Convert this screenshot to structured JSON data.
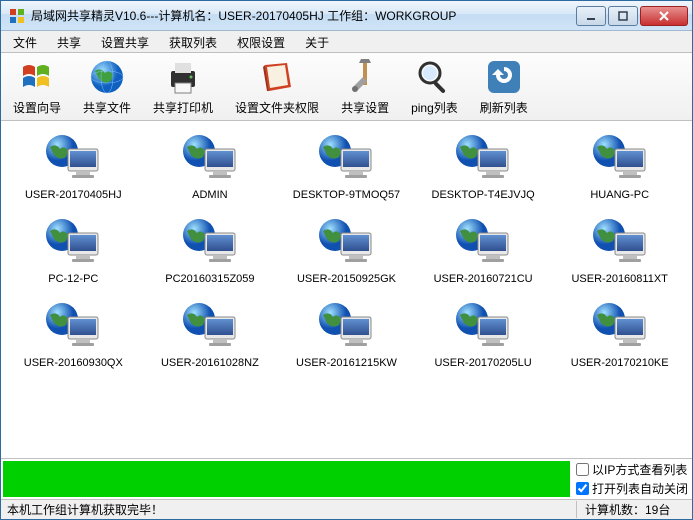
{
  "title": "局域网共享精灵V10.6---计算机名：USER-20170405HJ  工作组：WORKGROUP",
  "menu": [
    "文件",
    "共享",
    "设置共享",
    "获取列表",
    "权限设置",
    "关于"
  ],
  "toolbar": [
    {
      "label": "设置向导",
      "icon": "windows-flag"
    },
    {
      "label": "共享文件",
      "icon": "globe"
    },
    {
      "label": "共享打印机",
      "icon": "printer"
    },
    {
      "label": "设置文件夹权限",
      "icon": "book"
    },
    {
      "label": "共享设置",
      "icon": "tools"
    },
    {
      "label": "ping列表",
      "icon": "magnifier"
    },
    {
      "label": "刷新列表",
      "icon": "refresh"
    }
  ],
  "computers": [
    "USER-20170405HJ",
    "ADMIN",
    "DESKTOP-9TMOQ57",
    "DESKTOP-T4EJVJQ",
    "HUANG-PC",
    "PC-12-PC",
    "PC20160315Z059",
    "USER-20150925GK",
    "USER-20160721CU",
    "USER-20160811XT",
    "USER-20160930QX",
    "USER-20161028NZ",
    "USER-20161215KW",
    "USER-20170205LU",
    "USER-20170210KE"
  ],
  "options": {
    "ip_view": "以IP方式查看列表",
    "auto_close": "打开列表自动关闭"
  },
  "options_checked": {
    "ip_view": false,
    "auto_close": true
  },
  "status": {
    "left": "本机工作组计算机获取完毕！",
    "right": "计算机数：19台"
  }
}
